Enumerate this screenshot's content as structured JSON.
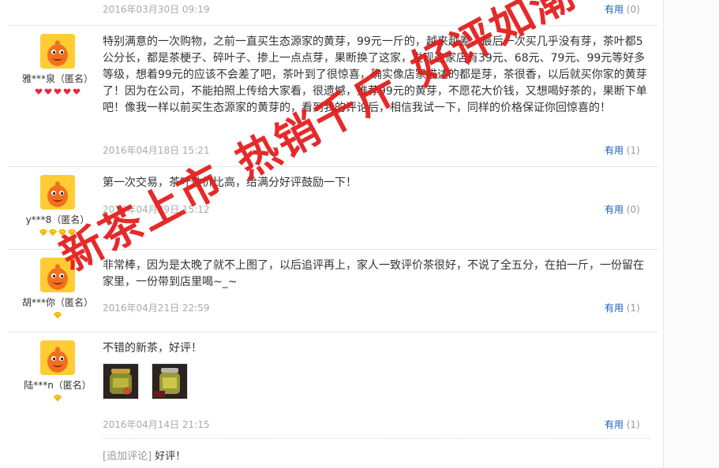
{
  "reviews": [
    {
      "text": "",
      "date": "2016年03月30日 09:19",
      "useful_label": "有用",
      "useful_count": "(0)"
    },
    {
      "user": "雅***泉（匿名）",
      "text": "特别满意的一次购物，之前一直买生态源家的黄芽，99元一斤的，越来越差，最后一次买几乎没有芽，茶叶都5公分长，都是茶梗子、碎叶子、掺上一点点芽，果断换了这家，发现这家店有39元、68元、79元、99元等好多等级，想着99元的应该不会差了吧，茶叶到了很惊喜，确实像店家描述的都是芽，茶很香，以后就买你家的黄芽了！因为在公司，不能拍照上传给大家看，很遗憾，推荐99元的黄芽，不愿花大价钱，又想喝好茶的，果断下单吧！像我一样以前买生态源家的黄芽的，看到我的评论后，相信我试一下，同样的价格保证你回惊喜的！",
      "date": "2016年04月18日 15:21",
      "useful_label": "有用",
      "useful_count": "(1)",
      "badge_type": "heart",
      "badge_count": 5
    },
    {
      "user": "y***8（匿名）",
      "text": "第一次交易，茶叶性价比高，给满分好评鼓励一下！",
      "date": "2016年04月29日 15:12",
      "useful_label": "有用",
      "useful_count": "(0)",
      "badge_type": "diamond",
      "badge_count": 4
    },
    {
      "user": "胡***你（匿名）",
      "text": "非常棒，因为是太晚了就不上图了，以后追评再上，家人一致评价茶很好，不说了全五分，在拍一斤，一份留在家里，一份带到店里喝~_~",
      "date": "2016年04月21日 22:59",
      "useful_label": "有用",
      "useful_count": "(1)",
      "badge_type": "diamond",
      "badge_count": 1
    },
    {
      "user": "陆***n（匿名）",
      "text": "不错的新茶，好评！",
      "date": "2016年04月14日 21:15",
      "useful_label": "有用",
      "useful_count": "(1)",
      "badge_type": "diamond",
      "badge_count": 1,
      "followup_tag": "[追加评论]",
      "followup_text": "好评！"
    }
  ],
  "watermark": {
    "parts": [
      "新茶上市",
      "热销千斤",
      "好评如潮"
    ]
  },
  "colors": {
    "useful_link": "#1a5dbd",
    "date_gray": "#aaaaaa",
    "watermark_red": "#e41818",
    "avatar_yellow": "#ffcc33",
    "heart_red": "#e8283c",
    "diamond_gold": "#f4b400"
  }
}
